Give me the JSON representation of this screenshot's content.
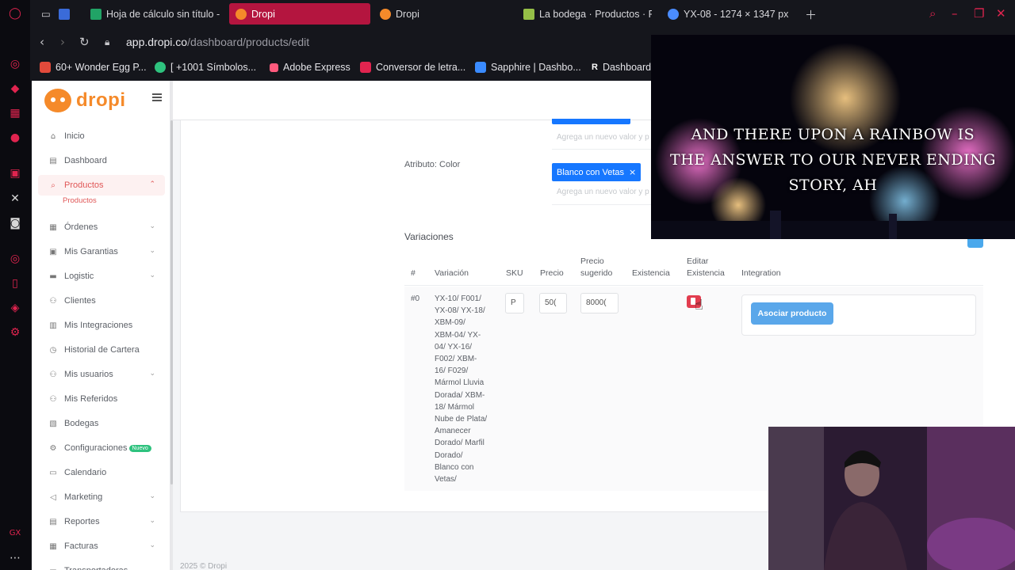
{
  "browser": {
    "tabs": [
      {
        "label": "Hoja de cálculo sin título -",
        "color": "#21a366"
      },
      {
        "label": "Dropi",
        "color": "#f58a2a",
        "active": true
      },
      {
        "label": "Dropi",
        "color": "#f58a2a"
      },
      {
        "label": "La bodega · Productos · Pa",
        "color": "#95bf47"
      },
      {
        "label": "YX-08 - 1274 × 1347 px",
        "color": "#4a8cff"
      }
    ],
    "url_host": "app.dropi.co",
    "url_path": "/dashboard/products/edit",
    "bookmarks": [
      {
        "label": "60+ Wonder Egg P...",
        "color": "#e24a3b"
      },
      {
        "label": "[ +1001 Símbolos...",
        "color": "#2ec27e"
      },
      {
        "label": "Adobe Express",
        "color": "#ff5a7d"
      },
      {
        "label": "Conversor de letra...",
        "color": "#e0244f"
      },
      {
        "label": "Sapphire | Dashbo...",
        "color": "#3a8bff"
      },
      {
        "label": "Dashboard",
        "color": "#ffffff"
      }
    ]
  },
  "brand": {
    "name": "dropi",
    "color": "#f58a2a"
  },
  "sidebar": {
    "items": [
      {
        "label": "Inicio",
        "icon": "home-icon"
      },
      {
        "label": "Dashboard",
        "icon": "dashboard-icon"
      },
      {
        "label": "Productos",
        "icon": "search-icon",
        "active": true
      },
      {
        "label": "Órdenes",
        "icon": "orders-icon",
        "chevron": true
      },
      {
        "label": "Mis Garantias",
        "icon": "warranty-icon",
        "chevron": true
      },
      {
        "label": "Logistic",
        "icon": "truck-icon",
        "chevron": true
      },
      {
        "label": "Clientes",
        "icon": "clients-icon"
      },
      {
        "label": "Mis Integraciones",
        "icon": "integrations-icon"
      },
      {
        "label": "Historial de Cartera",
        "icon": "history-icon"
      },
      {
        "label": "Mis usuarios",
        "icon": "users-icon",
        "chevron": true
      },
      {
        "label": "Mis Referidos",
        "icon": "referrals-icon"
      },
      {
        "label": "Bodegas",
        "icon": "warehouse-icon"
      },
      {
        "label": "Configuraciones",
        "icon": "settings-icon",
        "badge": "Nuevo"
      },
      {
        "label": "Calendario",
        "icon": "calendar-icon"
      },
      {
        "label": "Marketing",
        "icon": "megaphone-icon",
        "chevron": true
      },
      {
        "label": "Reportes",
        "icon": "reports-icon",
        "chevron": true
      },
      {
        "label": "Facturas",
        "icon": "invoice-icon",
        "chevron": true
      },
      {
        "label": "Transportadoras",
        "icon": "carrier-icon"
      }
    ],
    "sub_item": "Productos"
  },
  "attributes": {
    "hint": "Agrega un nuevo valor y p",
    "color_label": "Atributo: Color",
    "color_chip": "Blanco con Vetas"
  },
  "variations": {
    "title": "Variaciones",
    "headers": {
      "num": "#",
      "variation": "Variación",
      "sku": "SKU",
      "price": "Precio",
      "suggested_1": "Precio",
      "suggested_2": "sugerido",
      "stock": "Existencia",
      "edit_1": "Editar",
      "edit_2": "Existencia",
      "integration": "Integration"
    },
    "row": {
      "num": "#0",
      "variation_lines": [
        "YX-10/ F001/",
        "YX-08/ YX-18/",
        "XBM-09/",
        "XBM-04/ YX-",
        "04/ YX-16/",
        "F002/ XBM-",
        "16/ F029/",
        "Mármol Lluvia",
        "Dorada/ XBM-",
        "18/ Mármol",
        "Nube de Plata/",
        "Amanecer",
        "Dorado/ Marfil",
        "Dorado/",
        "Blanco con",
        "Vetas/"
      ],
      "sku": "P",
      "price": "50(",
      "suggested": "8000(",
      "associate_label": "Asociar producto"
    }
  },
  "footer": "2025 © Dropi",
  "overlay": {
    "lyrics_1": "AND THERE UPON A RAINBOW IS",
    "lyrics_2": "THE ANSWER TO OUR NEVER ENDING STORY, AH"
  }
}
